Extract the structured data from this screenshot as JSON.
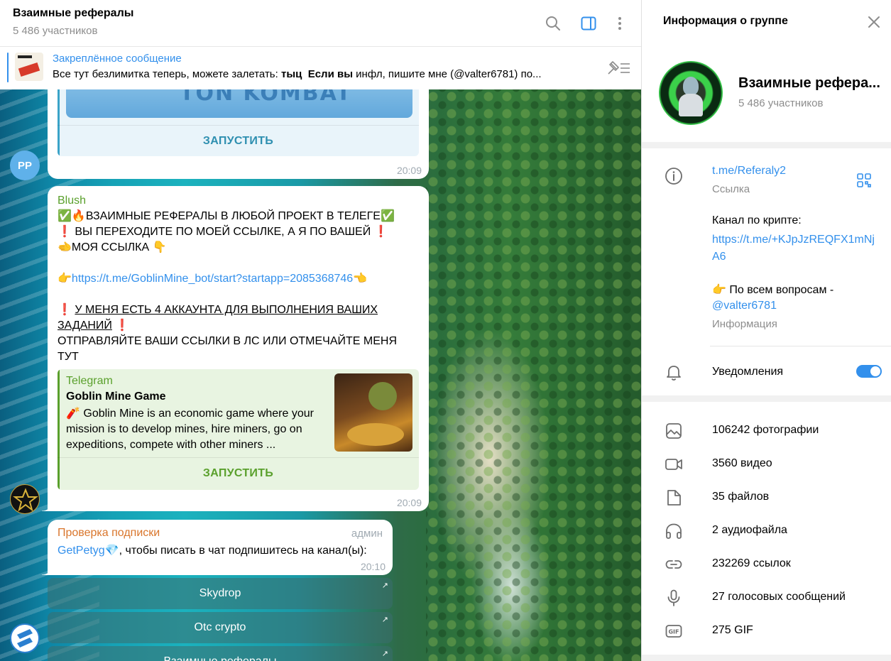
{
  "chat": {
    "title": "Взаимные рефералы",
    "members": "5 486 участников"
  },
  "pinned": {
    "title": "Закреплённое сообщение",
    "text_part1": "Все тут безлимитка теперь, можете залетать: ",
    "text_bold1": "тыц",
    "text_bold2": "Если вы",
    "text_part2": " инфл, пишите мне (@valter6781) по..."
  },
  "messages": [
    {
      "avatar_initials": "PP",
      "image_text": "TON KOMBAT",
      "launch_label": "ЗАПУСТИТЬ",
      "time": "20:09"
    },
    {
      "sender": "Blush",
      "line1": "✅🔥ВЗАИМНЫЕ РЕФЕРАЛЫ В ЛЮБОЙ ПРОЕКТ В ТЕЛЕГЕ✅",
      "line2": "❗ ВЫ ПЕРЕХОДИТЕ ПО МОЕЙ ССЫЛКЕ, А Я ПО ВАШЕЙ ❗",
      "line3": "🫲МОЯ ССЫЛКА 👇",
      "link_prefix": "👉",
      "link": "https://t.me/GoblinMine_bot/start?startapp=2085368746",
      "link_suffix": "👈",
      "line4_prefix": "❗ ",
      "line4": "У МЕНЯ ЕСТЬ 4  АККАУНТА ДЛЯ ВЫПОЛНЕНИЯ ВАШИХ ЗАДАНИЙ",
      "line4_suffix": " ❗",
      "line5": "ОТПРАВЛЯЙТЕ ВАШИ ССЫЛКИ В ЛС ИЛИ ОТМЕЧАЙТЕ МЕНЯ ТУТ",
      "preview_site": "Telegram",
      "preview_title": "Goblin Mine Game",
      "preview_desc": "🧨 Goblin Mine is an economic game where your mission is to develop mines, hire miners, go on expeditions, compete with other miners ...",
      "launch_label": "ЗАПУСТИТЬ",
      "time": "20:09"
    },
    {
      "sender": "Проверка подписки",
      "role": "админ",
      "mention": "GetPetyg💎",
      "text": ", чтобы писать в чат подпишитесь на канал(ы):",
      "time": "20:10",
      "buttons": [
        "Skydrop",
        "Otc crypto",
        "Взаимные рефералы"
      ]
    }
  ],
  "panel": {
    "title": "Информация о группе",
    "group_name": "Взаимные рефера...",
    "members": "5 486 участников",
    "link": "t.me/Referaly2",
    "link_caption": "Ссылка",
    "desc_line1": "Канал по крипте:",
    "desc_link": "https://t.me/+KJpJzREQFX1mNjA6",
    "desc_line2": "👉 По всем вопросам -",
    "desc_mention": "@valter6781",
    "desc_caption": "Информация",
    "notifications": "Уведомления",
    "notifications_on": true,
    "media": [
      {
        "icon": "photo-icon",
        "label": "106242 фотографии"
      },
      {
        "icon": "video-icon",
        "label": "3560 видео"
      },
      {
        "icon": "file-icon",
        "label": "35 файлов"
      },
      {
        "icon": "headphones-icon",
        "label": "2 аудиофайла"
      },
      {
        "icon": "link-icon",
        "label": "232269 ссылок"
      },
      {
        "icon": "microphone-icon",
        "label": "27 голосовых сообщений"
      },
      {
        "icon": "gif-icon",
        "label": "275 GIF"
      }
    ]
  },
  "colors": {
    "accent": "#3390ec",
    "sender_green": "#5aa02c",
    "sender_orange": "#d9752b",
    "webapp_teal": "#2e8fb0",
    "time_gray": "#a0aab2"
  }
}
